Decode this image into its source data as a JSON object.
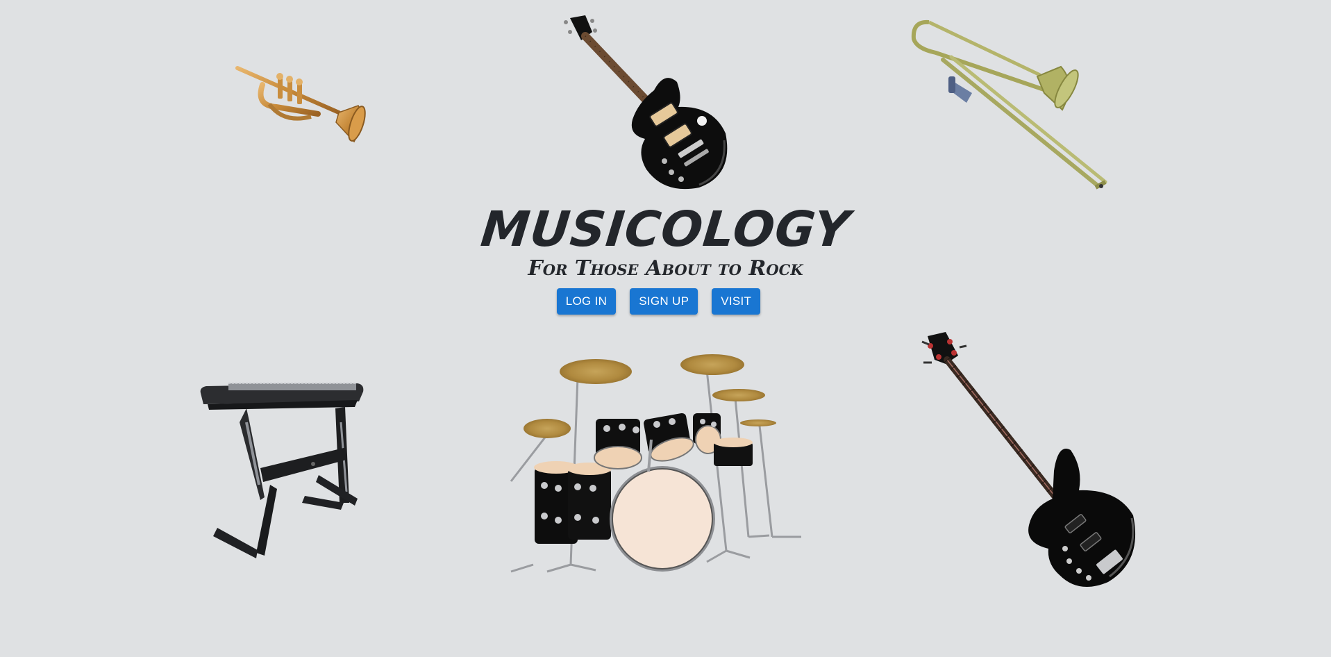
{
  "brand": {
    "title": "MUSICOLOGY",
    "tagline": "For Those About to Rock"
  },
  "actions": {
    "login_label": "LOG IN",
    "signup_label": "SIGN UP",
    "visit_label": "VISIT"
  },
  "instruments": [
    "trumpet",
    "electric-guitar",
    "trombone",
    "keyboard",
    "drum-kit",
    "bass-guitar"
  ],
  "colors": {
    "background": "#dfe1e3",
    "button": "#1976d2",
    "button_text": "#ffffff",
    "title": "#23262b"
  }
}
